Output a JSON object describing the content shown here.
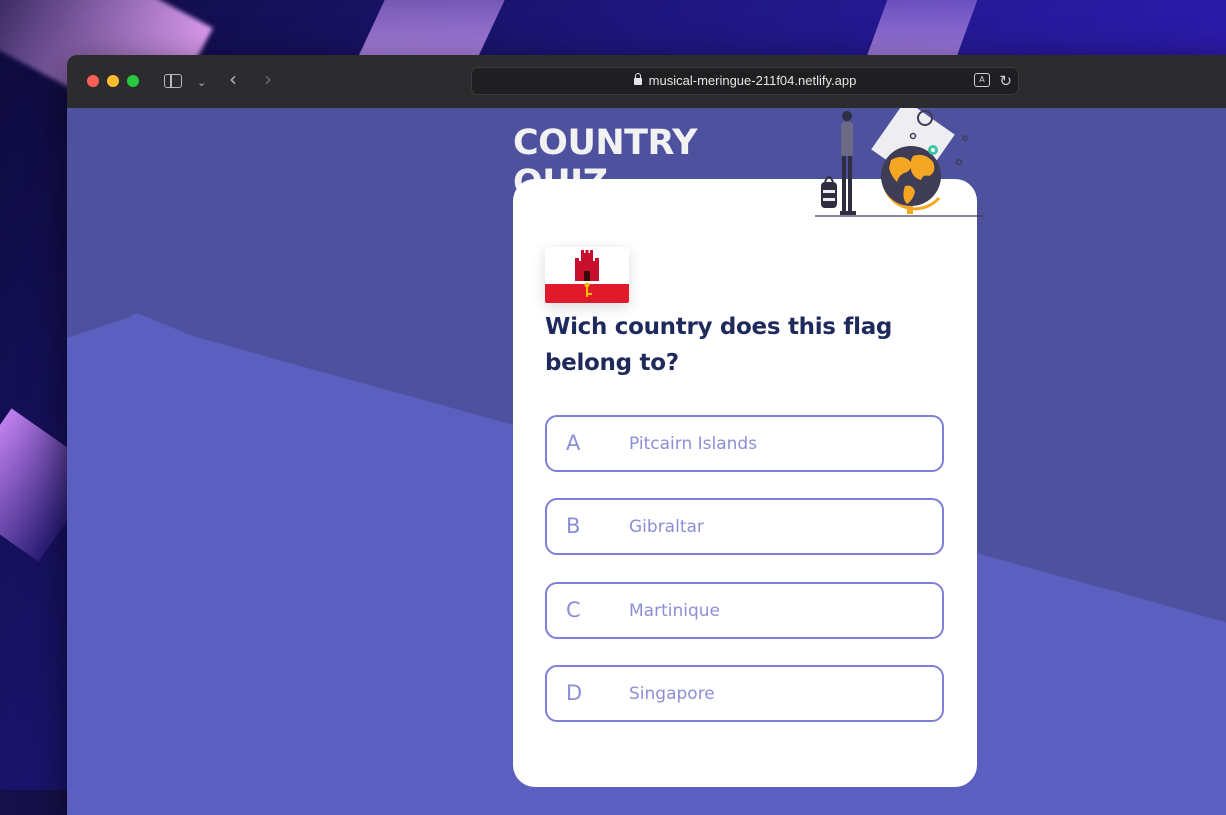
{
  "browser": {
    "url": "musical-meringue-211f04.netlify.app"
  },
  "quiz": {
    "title": "COUNTRY QUIZ",
    "question": "Wich country does this flag belong to?",
    "flag_colors": {
      "top": "#ffffff",
      "bottom": "#e01a2a",
      "castle": "#c8102e",
      "key": "#f1bf00"
    },
    "options": [
      {
        "letter": "A",
        "text": "Pitcairn Islands"
      },
      {
        "letter": "B",
        "text": "Gibraltar"
      },
      {
        "letter": "C",
        "text": "Martinique"
      },
      {
        "letter": "D",
        "text": "Singapore"
      }
    ]
  },
  "theme": {
    "page_bg": "#5b5fc0",
    "card_bg": "#ffffff",
    "question_color": "#1f2a5c",
    "option_border": "#7d7fd9",
    "option_text": "#8c8ed6"
  }
}
